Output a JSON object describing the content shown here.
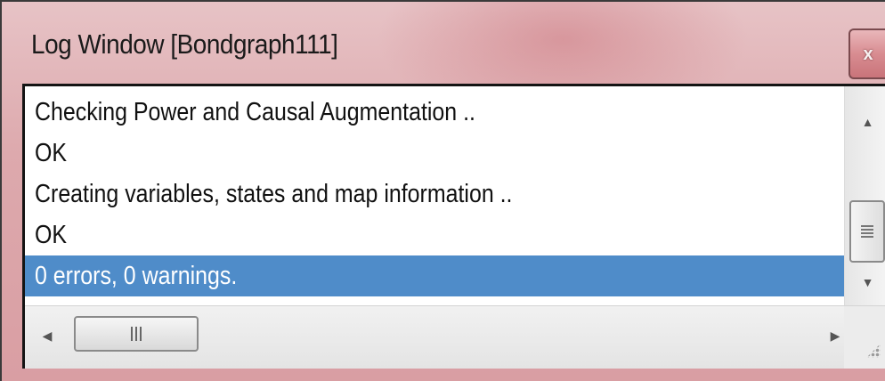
{
  "window": {
    "title": "Log Window [Bondgraph111]",
    "close_label": "x"
  },
  "log": {
    "lines": [
      {
        "text": "Checking Power and Causal Augmentation ..",
        "selected": false
      },
      {
        "text": "OK",
        "selected": false
      },
      {
        "text": "Creating variables, states and map information ..",
        "selected": false
      },
      {
        "text": "OK",
        "selected": false
      },
      {
        "text": "0 errors, 0 warnings.",
        "selected": true
      }
    ],
    "selection_color": "#4f8cc9"
  },
  "scrollbars": {
    "vertical": {
      "up_icon": "arrow-up-icon",
      "down_icon": "arrow-down-icon",
      "thumb_grip": "grip-icon"
    },
    "horizontal": {
      "left_icon": "arrow-left-icon",
      "right_icon": "arrow-right-icon",
      "thumb_grip": "grip-icon"
    }
  }
}
